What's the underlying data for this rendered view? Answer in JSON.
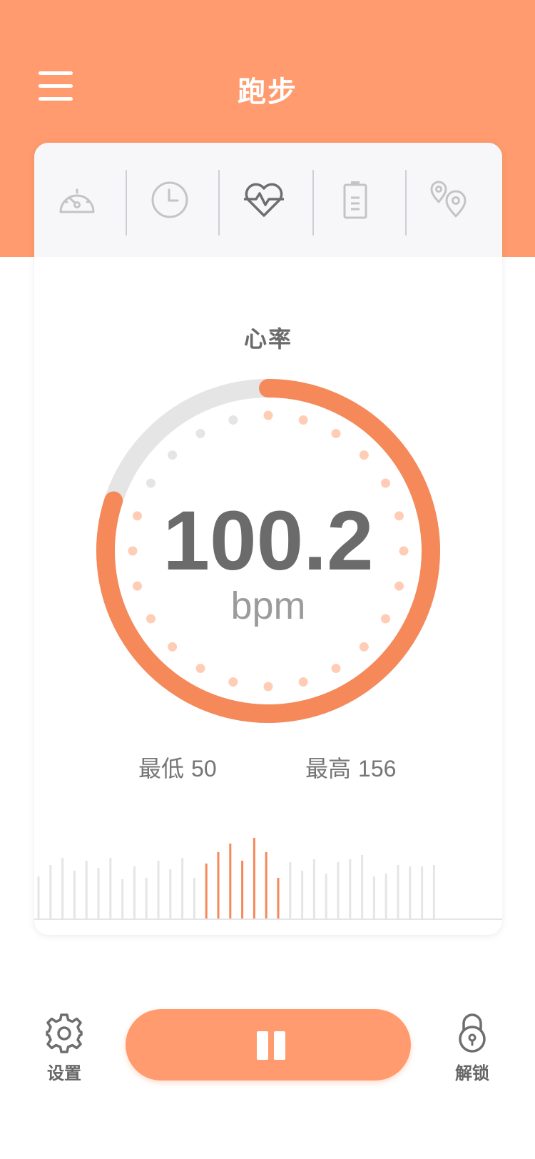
{
  "header": {
    "title": "跑步",
    "menu_icon": "hamburger-menu-icon",
    "background": "#FF9B6E"
  },
  "tabs": [
    {
      "icon": "speedometer-icon",
      "active": false
    },
    {
      "icon": "clock-icon",
      "active": false
    },
    {
      "icon": "heart-rate-icon",
      "active": true
    },
    {
      "icon": "battery-icon",
      "active": false
    },
    {
      "icon": "location-pins-icon",
      "active": false
    }
  ],
  "heart_rate": {
    "label": "心率",
    "value": "100.2",
    "unit": "bpm",
    "progress_fraction": 0.8,
    "min_label": "最低",
    "min_value": "50",
    "max_label": "最高",
    "max_value": "156"
  },
  "history": {
    "bars": [
      30,
      38,
      43,
      34,
      41,
      36,
      43,
      28,
      37,
      29,
      41,
      35,
      43,
      29,
      39,
      47,
      53,
      41,
      57,
      47,
      29,
      40,
      34,
      42,
      32,
      40,
      42,
      45,
      30,
      32,
      38,
      37,
      37,
      38
    ],
    "highlight_start": 14,
    "highlight_end": 20
  },
  "bottom": {
    "settings_label": "设置",
    "settings_icon": "gear-icon",
    "pause_icon": "pause-icon",
    "unlock_label": "解锁",
    "unlock_icon": "lock-icon"
  },
  "colors": {
    "accent": "#FF9B6E",
    "accent_dark": "#F5895A",
    "accent_light": "#FFCDB6",
    "track": "#E5E5E5",
    "text_dark": "#6B6B6B"
  }
}
